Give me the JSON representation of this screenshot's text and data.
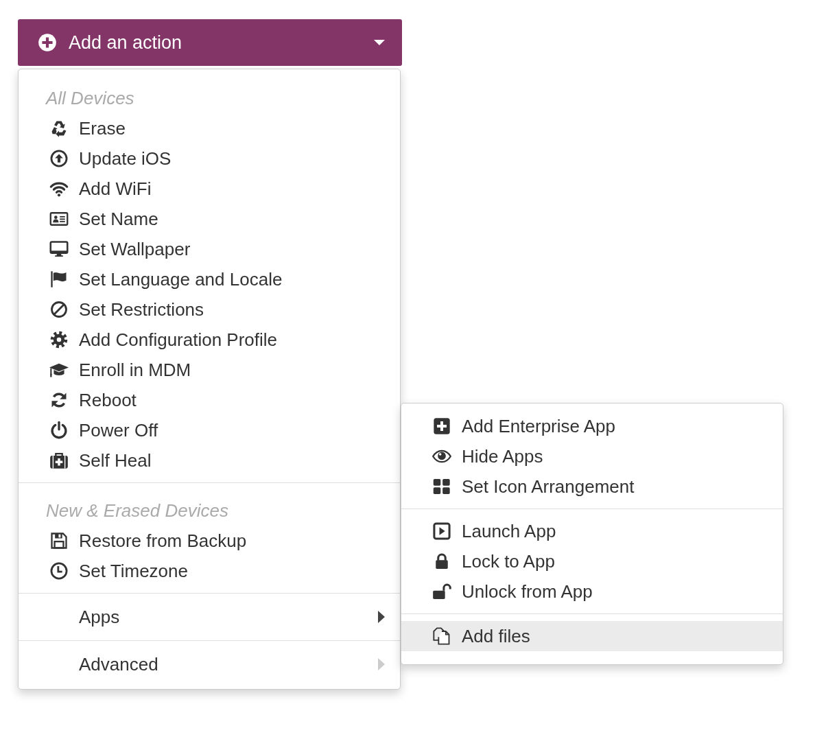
{
  "action_button": {
    "label": "Add an action"
  },
  "menu": {
    "sections": [
      {
        "kind": "actions",
        "header": "All Devices",
        "items": [
          {
            "label": "Erase"
          },
          {
            "label": "Update iOS"
          },
          {
            "label": "Add WiFi"
          },
          {
            "label": "Set Name"
          },
          {
            "label": "Set Wallpaper"
          },
          {
            "label": "Set Language and Locale"
          },
          {
            "label": "Set Restrictions"
          },
          {
            "label": "Add Configuration Profile"
          },
          {
            "label": "Enroll in MDM"
          },
          {
            "label": "Reboot"
          },
          {
            "label": "Power Off"
          },
          {
            "label": "Self Heal"
          }
        ]
      },
      {
        "kind": "actions",
        "header": "New & Erased Devices",
        "items": [
          {
            "label": "Restore from Backup"
          },
          {
            "label": "Set Timezone"
          }
        ]
      },
      {
        "kind": "submenu",
        "label": "Apps",
        "expanded": true
      },
      {
        "kind": "submenu",
        "label": "Advanced",
        "expanded": false
      }
    ]
  },
  "submenu": {
    "groups": [
      {
        "items": [
          {
            "label": "Add Enterprise App",
            "hovered": false
          },
          {
            "label": "Hide Apps",
            "hovered": false
          },
          {
            "label": "Set Icon Arrangement",
            "hovered": false
          }
        ]
      },
      {
        "items": [
          {
            "label": "Launch App",
            "hovered": false
          },
          {
            "label": "Lock to App",
            "hovered": false
          },
          {
            "label": "Unlock from App",
            "hovered": false
          }
        ]
      },
      {
        "items": [
          {
            "label": "Add files",
            "hovered": true
          }
        ]
      }
    ]
  }
}
